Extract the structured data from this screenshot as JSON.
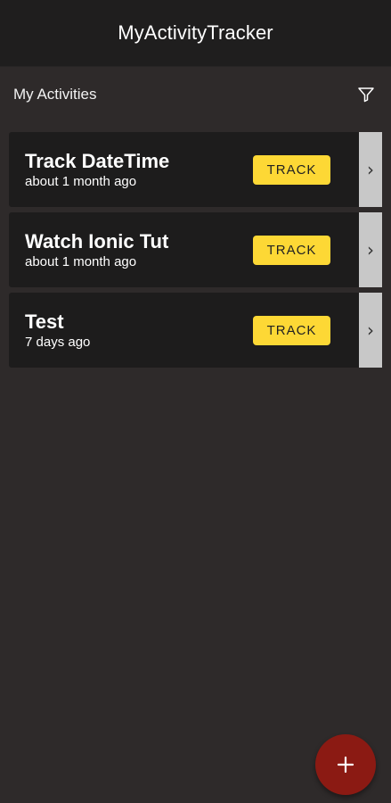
{
  "app": {
    "title": "MyActivityTracker"
  },
  "section": {
    "title": "My Activities",
    "filter_icon": "filter-icon"
  },
  "activities": [
    {
      "title": "Track DateTime",
      "subtitle": "about 1 month ago",
      "action_label": "TRACK"
    },
    {
      "title": "Watch Ionic Tut",
      "subtitle": "about 1 month ago",
      "action_label": "TRACK"
    },
    {
      "title": "Test",
      "subtitle": "7 days ago",
      "action_label": "TRACK"
    }
  ],
  "fab": {
    "icon": "plus-icon"
  },
  "colors": {
    "background": "#2e2a2a",
    "toolbar": "#1f1e1e",
    "card": "#1d1c1c",
    "track_button": "#fdd835",
    "fab": "#8b1a13",
    "detail_button": "#c8c8c8"
  }
}
